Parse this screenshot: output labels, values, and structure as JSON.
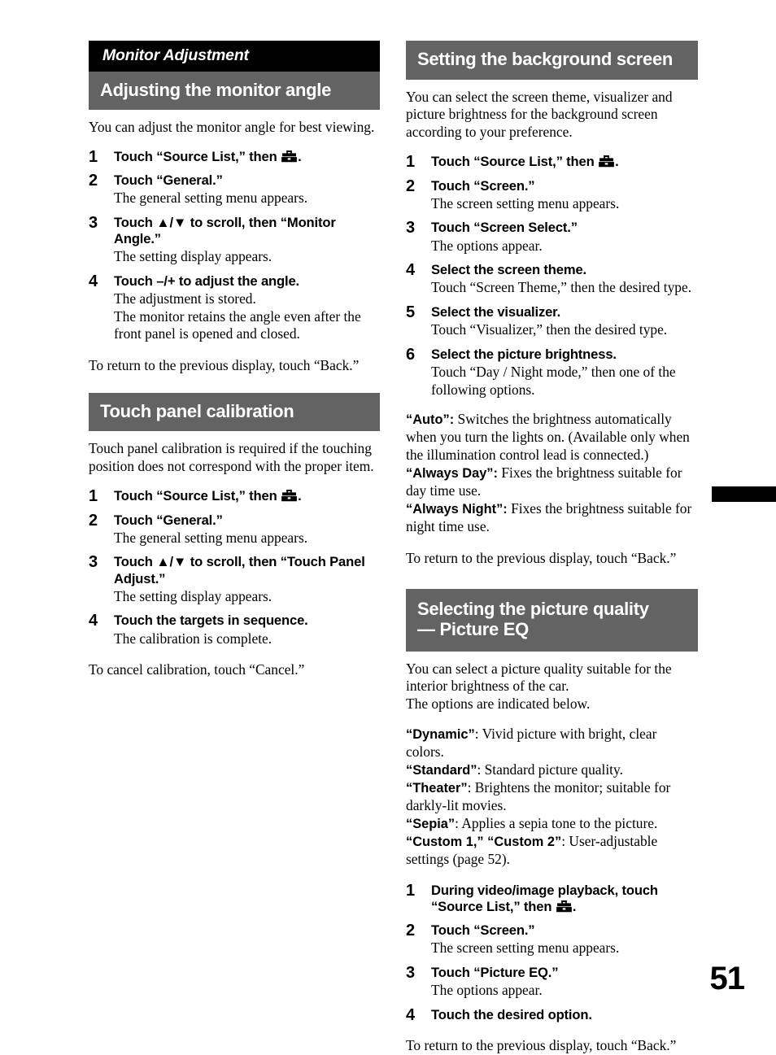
{
  "page": {
    "number": "51",
    "edge_tab_color": "#000000",
    "header_black_color": "#000000",
    "header_gray_color": "#636363"
  },
  "left_column": {
    "running_head": "Monitor Adjustment",
    "section_monitor_angle": {
      "heading": "Adjusting the monitor angle",
      "intro": "You can adjust the monitor angle for best viewing.",
      "steps": [
        {
          "num": "1",
          "title_pre": "Touch “Source List,” then ",
          "title_icon": "toolbox-icon",
          "title_post": ".",
          "desc": ""
        },
        {
          "num": "2",
          "title_pre": "Touch “General.”",
          "title_icon": "",
          "title_post": "",
          "desc": "The general setting menu appears."
        },
        {
          "num": "3",
          "title_pre": "Touch ▲/▼ to scroll, then “Monitor Angle.”",
          "title_icon": "",
          "title_post": "",
          "desc": "The setting display appears."
        },
        {
          "num": "4",
          "title_pre": "Touch –/+ to adjust the angle.",
          "title_icon": "",
          "title_post": "",
          "desc": "The adjustment is stored.\nThe monitor retains the angle even after the front panel is opened and closed."
        }
      ],
      "closing": "To return to the previous display, touch “Back.”"
    },
    "section_touch_panel": {
      "heading": "Touch panel calibration",
      "intro": "Touch panel calibration is required if the touching position does not correspond with the proper item.",
      "steps": [
        {
          "num": "1",
          "title_pre": "Touch “Source List,” then ",
          "title_icon": "toolbox-icon",
          "title_post": ".",
          "desc": ""
        },
        {
          "num": "2",
          "title_pre": "Touch “General.”",
          "title_icon": "",
          "title_post": "",
          "desc": "The general setting menu appears."
        },
        {
          "num": "3",
          "title_pre": "Touch ▲/▼ to scroll, then “Touch Panel Adjust.”",
          "title_icon": "",
          "title_post": "",
          "desc": "The setting display appears."
        },
        {
          "num": "4",
          "title_pre": "Touch the targets in sequence.",
          "title_icon": "",
          "title_post": "",
          "desc": "The calibration is complete."
        }
      ],
      "closing": "To cancel calibration, touch “Cancel.”"
    }
  },
  "right_column": {
    "section_background_screen": {
      "heading": "Setting the background screen",
      "intro": "You can select the screen theme, visualizer and picture brightness for the background screen according to your preference.",
      "steps": [
        {
          "num": "1",
          "title_pre": "Touch “Source List,” then ",
          "title_icon": "toolbox-icon",
          "title_post": ".",
          "desc": ""
        },
        {
          "num": "2",
          "title_pre": "Touch “Screen.”",
          "title_icon": "",
          "title_post": "",
          "desc": "The screen setting menu appears."
        },
        {
          "num": "3",
          "title_pre": "Touch “Screen Select.”",
          "title_icon": "",
          "title_post": "",
          "desc": "The options appear."
        },
        {
          "num": "4",
          "title_pre": "Select the screen theme.",
          "title_icon": "",
          "title_post": "",
          "desc": "Touch “Screen Theme,” then the desired type."
        },
        {
          "num": "5",
          "title_pre": "Select the visualizer.",
          "title_icon": "",
          "title_post": "",
          "desc": "Touch “Visualizer,” then the desired type."
        },
        {
          "num": "6",
          "title_pre": "Select the picture brightness.",
          "title_icon": "",
          "title_post": "",
          "desc": "Touch “Day / Night mode,” then one of the following options."
        }
      ],
      "options": [
        {
          "term": "“Auto”:",
          "definition": " Switches the brightness automatically when you turn the lights on. (Available only when the illumination control lead is connected.)"
        },
        {
          "term": "“Always Day”:",
          "definition": " Fixes the brightness suitable for day time use."
        },
        {
          "term": "“Always Night”:",
          "definition": " Fixes the brightness suitable for night time use."
        }
      ],
      "closing": "To return to the previous display, touch “Back.”"
    },
    "section_picture_eq": {
      "heading_line1": "Selecting the picture quality",
      "heading_line2": "— Picture EQ",
      "intro": "You can select a picture quality suitable for the interior brightness of the car.\nThe options are indicated below.",
      "options": [
        {
          "term": "“Dynamic”",
          "definition": ": Vivid picture with bright, clear colors."
        },
        {
          "term": "“Standard”",
          "definition": ": Standard picture quality."
        },
        {
          "term": "“Theater”",
          "definition": ": Brightens the monitor; suitable for darkly-lit movies."
        },
        {
          "term": "“Sepia”",
          "definition": ": Applies a sepia tone to the picture."
        },
        {
          "term": "“Custom 1,” “Custom 2”",
          "definition": ": User-adjustable settings (page 52)."
        }
      ],
      "steps": [
        {
          "num": "1",
          "title_pre": "During video/image playback, touch “Source List,” then ",
          "title_icon": "toolbox-icon",
          "title_post": ".",
          "desc": ""
        },
        {
          "num": "2",
          "title_pre": "Touch “Screen.”",
          "title_icon": "",
          "title_post": "",
          "desc": "The screen setting menu appears."
        },
        {
          "num": "3",
          "title_pre": "Touch “Picture EQ.”",
          "title_icon": "",
          "title_post": "",
          "desc": "The options appear."
        },
        {
          "num": "4",
          "title_pre": "Touch the desired option.",
          "title_icon": "",
          "title_post": "",
          "desc": ""
        }
      ],
      "closing": "To return to the previous display, touch “Back.”"
    }
  }
}
